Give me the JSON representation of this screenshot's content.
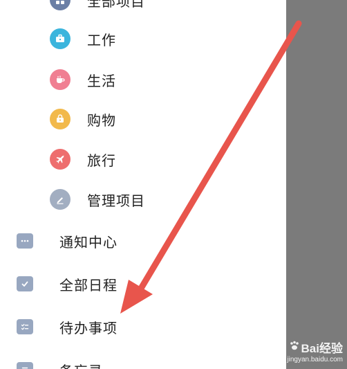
{
  "drawer": {
    "sub_items": [
      {
        "label": "全部项目",
        "icon": "all-projects-icon",
        "color": "#6b7fa6"
      },
      {
        "label": "工作",
        "icon": "briefcase-icon",
        "color": "#3bb5dd"
      },
      {
        "label": "生活",
        "icon": "cup-icon",
        "color": "#f07f92"
      },
      {
        "label": "购物",
        "icon": "shopping-bag-icon",
        "color": "#f2b94b"
      },
      {
        "label": "旅行",
        "icon": "airplane-icon",
        "color": "#ee6e6e"
      },
      {
        "label": "管理项目",
        "icon": "edit-pencil-icon",
        "color": "#a2aec1"
      }
    ],
    "main_items": [
      {
        "label": "通知中心",
        "icon": "chat-bubble-icon"
      },
      {
        "label": "全部日程",
        "icon": "calendar-check-icon"
      },
      {
        "label": "待办事项",
        "icon": "checklist-icon"
      },
      {
        "label": "备忘录",
        "icon": "memo-icon"
      }
    ]
  },
  "overlay": {
    "color": "#7b7b7b"
  },
  "annotation": {
    "arrow_color": "#e8554c"
  },
  "watermark": {
    "line1": "Bai经验",
    "line2": "jingyan.baidu.com"
  }
}
